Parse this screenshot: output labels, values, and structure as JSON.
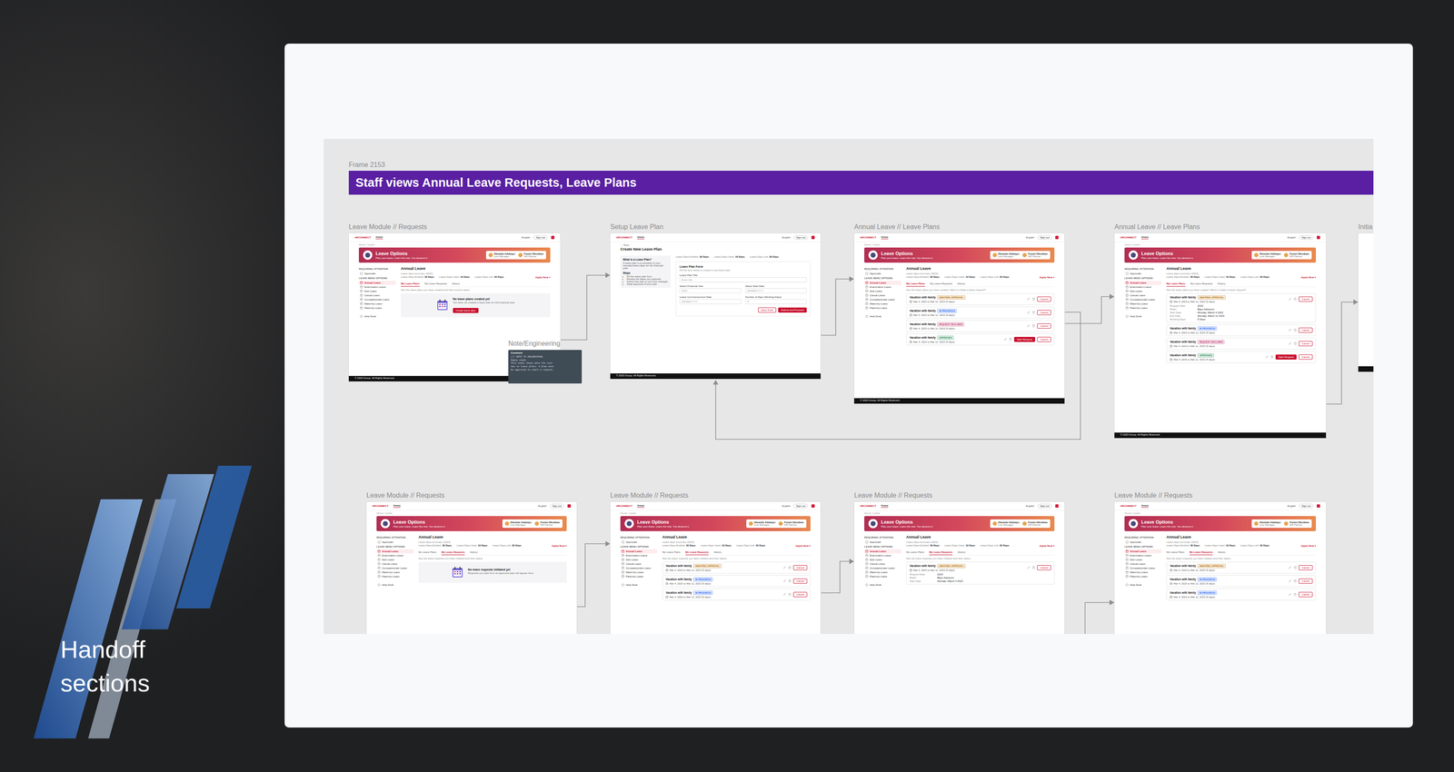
{
  "slide": {
    "title": "Handoff sections"
  },
  "canvas": {
    "frame_name": "Frame 2153",
    "banner": "Staff views Annual Leave Requests, Leave Plans",
    "shell": {
      "logo": "HRCONNECT",
      "nav": "Home",
      "language": "English",
      "sign_out": "Sign out",
      "breadcrumb": "Home / Leave",
      "hero": {
        "title": "Leave Options",
        "subtitle": "Plan your leave. Learn the rest. You deserve it."
      },
      "people": [
        {
          "name": "Olumide Adebayo",
          "role": "Line Manager"
        },
        {
          "name": "Funmi Okonkwo",
          "role": "HR Partner"
        }
      ],
      "attention_heading": "REQUIRING ATTENTION",
      "attention_item": "Approvals",
      "menu_heading": "LEAVE MENU OPTIONS",
      "menu": [
        {
          "label": "Annual Leave",
          "selected": true
        },
        {
          "label": "Examination Leave",
          "selected": false
        },
        {
          "label": "Sick Leave",
          "selected": false
        },
        {
          "label": "Casual Leave",
          "selected": false
        },
        {
          "label": "Compassionate Leave",
          "selected": false
        },
        {
          "label": "Maternity Leave",
          "selected": false
        },
        {
          "label": "Paternity Leave",
          "selected": false
        }
      ],
      "help": "Help Desk",
      "page_title": "Annual Leave",
      "stats_caption": "Leave days summary (2023)",
      "stats": [
        {
          "label": "Leave Days Entitled",
          "value": "30 Days"
        },
        {
          "label": "Leave Days Used",
          "value": "10 Days"
        },
        {
          "label": "Leave Days Left",
          "value": "20 Days"
        }
      ],
      "apply": "Apply Now ▾",
      "footer": "© 2023 Group. All Rights Reserved."
    },
    "note": {
      "label": "Note/Engineering",
      "header": "Comment",
      "lines": [
        "/// NOTE TO ENGINEERING",
        "Empty state",
        "This state shows when the user",
        "has no leave plans. A plan must",
        "be approved to start a request."
      ]
    },
    "frames": [
      {
        "label": "Leave Module // Requests",
        "kind": "empty",
        "tabs": [
          {
            "label": "My Leave Plans",
            "selected": true
          },
          {
            "label": "My Leave Requests",
            "selected": false
          },
          {
            "label": "History",
            "selected": false
          }
        ],
        "tab_note": "See the leave plans you have created and their current status.",
        "empty": {
          "title": "No leave plans created yet",
          "text": "You have not created a leave plan for this financial year.",
          "button": "Create leave plan"
        }
      },
      {
        "label": "Setup Leave Plan",
        "kind": "form",
        "back": "← Back",
        "title": "Create New Leave Plan",
        "info": {
          "title": "What is a Leave Plan?",
          "text": "A leave plan is a schedule of your intended leave days for the financial year.",
          "steps_title": "Steps",
          "steps": [
            "Fill the leave plan form",
            "Review the dates you selected",
            "Submit the plan to your line manager",
            "Await approval of your plan"
          ]
        },
        "form": {
          "title": "Leave Plan Form",
          "text": "Fill the form below to create a new leave plan.",
          "fields": [
            {
              "label": "Leave Plan Title",
              "placeholder": "Enter title"
            },
            {
              "label": "Select Financial Year",
              "placeholder": "2023"
            },
            {
              "label": "Select Start Date",
              "placeholder": "DD/MM/YYYY"
            },
            {
              "label": "Leave Commencement Date",
              "placeholder": "DD/MM/YYYY"
            },
            {
              "label": "Number of Days (Working Days)",
              "placeholder": "0"
            }
          ],
          "buttons": [
            {
              "label": "Save Draft",
              "kind": "outline"
            },
            {
              "label": "Submit and Proceed",
              "kind": "primary"
            }
          ]
        }
      },
      {
        "label": "Annual Leave // Leave Plans",
        "kind": "list",
        "tabs": [
          {
            "label": "My Leave Plans",
            "selected": true
          },
          {
            "label": "My Leave Requests",
            "selected": false
          },
          {
            "label": "History",
            "selected": false
          }
        ],
        "tab_note": "See the leave plans you have created. Want to initiate a leave request?",
        "items": [
          {
            "title": "Vacation with family",
            "status": "AWAITING APPROVAL",
            "color": "#b86e00",
            "date": "Mar 4, 2023 to Mar 11, 2023 (5 days)",
            "expanded": false,
            "actions": [
              {
                "label": "Cancel",
                "kind": "outline"
              }
            ]
          },
          {
            "title": "Vacation with family",
            "status": "IN PROGRESS",
            "color": "#2563eb",
            "date": "Mar 4, 2023 to Mar 11, 2023 (5 days)",
            "expanded": false,
            "actions": [
              {
                "label": "Cancel",
                "kind": "outline"
              }
            ]
          },
          {
            "title": "Vacation with family",
            "status": "REQUEST DECLINED",
            "color": "#c0306a",
            "date": "Mar 4, 2023 to Mar 11, 2023 (5 days)",
            "expanded": false,
            "actions": [
              {
                "label": "Cancel",
                "kind": "outline"
              }
            ]
          },
          {
            "title": "Vacation with family",
            "status": "APPROVED",
            "color": "#1f8a55",
            "date": "Mar 4, 2023 to Mar 11, 2023 (5 days)",
            "expanded": false,
            "actions": [
              {
                "label": "Start Request",
                "kind": "primary"
              },
              {
                "label": "Cancel",
                "kind": "outline"
              }
            ]
          }
        ]
      },
      {
        "label": "Annual Leave // Leave Plans",
        "kind": "list",
        "tabs": [
          {
            "label": "My Leave Plans",
            "selected": true
          },
          {
            "label": "My Leave Requests",
            "selected": false
          },
          {
            "label": "History",
            "selected": false
          }
        ],
        "tab_note": "See the leave plans you have created. Want to initiate a leave request?",
        "items": [
          {
            "title": "Vacation with family",
            "status": "AWAITING APPROVAL",
            "color": "#b86e00",
            "date": "Mar 4, 2023 to Mar 11, 2023 (5 days)",
            "expanded": true,
            "actions": [
              {
                "label": "Cancel",
                "kind": "outline"
              }
            ],
            "details": [
              {
                "key": "Request Date",
                "value": "2023"
              },
              {
                "key": "Relief",
                "value": "Bayo Adewumi"
              },
              {
                "key": "Start Date",
                "value": "Monday, March 4 2023"
              },
              {
                "key": "End Date",
                "value": "Monday, March 11 2023"
              },
              {
                "key": "Working Days",
                "value": "5 Days"
              }
            ]
          },
          {
            "title": "Vacation with family",
            "status": "IN PROGRESS",
            "color": "#2563eb",
            "date": "Mar 4, 2023 to Mar 11, 2023 (5 days)",
            "expanded": false,
            "actions": [
              {
                "label": "Cancel",
                "kind": "outline"
              }
            ]
          },
          {
            "title": "Vacation with family",
            "status": "REQUEST DECLINED",
            "color": "#c0306a",
            "date": "Mar 4, 2023 to Mar 11, 2023 (5 days)",
            "expanded": false,
            "actions": [
              {
                "label": "Cancel",
                "kind": "outline"
              }
            ]
          },
          {
            "title": "Vacation with family",
            "status": "APPROVED",
            "color": "#1f8a55",
            "date": "Mar 4, 2023 to Mar 11, 2023 (5 days)",
            "expanded": false,
            "actions": [
              {
                "label": "Start Request",
                "kind": "primary"
              },
              {
                "label": "Cancel",
                "kind": "outline"
              }
            ]
          }
        ]
      },
      {
        "label": "Initia",
        "kind": "blank"
      },
      {
        "label": "Leave Module // Requests",
        "kind": "empty",
        "tabs": [
          {
            "label": "My Leave Plans",
            "selected": false
          },
          {
            "label": "My Leave Requests",
            "selected": true
          },
          {
            "label": "History",
            "selected": false
          }
        ],
        "tab_note": "See the leave requests you have initiated and their status.",
        "empty": {
          "title": "No leave requests initiated yet",
          "text": "Requests you start from an approved plan will appear here."
        }
      },
      {
        "label": "Leave Module // Requests",
        "kind": "list",
        "tabs": [
          {
            "label": "My Leave Plans",
            "selected": false
          },
          {
            "label": "My Leave Requests",
            "selected": true
          },
          {
            "label": "History",
            "selected": false
          }
        ],
        "tab_note": "See the leave requests you have initiated and their status.",
        "items": [
          {
            "title": "Vacation with family",
            "status": "AWAITING APPROVAL",
            "color": "#b86e00",
            "date": "Mar 4, 2023 to Mar 11, 2023 (5 days)",
            "expanded": false,
            "actions": [
              {
                "label": "Cancel",
                "kind": "outline"
              }
            ]
          },
          {
            "title": "Vacation with family",
            "status": "IN PROGRESS",
            "color": "#2563eb",
            "date": "Mar 4, 2023 to Mar 11, 2023 (5 days)",
            "expanded": false,
            "actions": [
              {
                "label": "Cancel",
                "kind": "outline"
              }
            ]
          },
          {
            "title": "Vacation with family",
            "status": "IN PROGRESS",
            "color": "#2563eb",
            "date": "Mar 4, 2023 to Mar 11, 2023 (5 days)",
            "expanded": false,
            "actions": [
              {
                "label": "Cancel",
                "kind": "outline"
              }
            ]
          }
        ]
      },
      {
        "label": "Leave Module // Requests",
        "kind": "list",
        "tabs": [
          {
            "label": "My Leave Plans",
            "selected": false
          },
          {
            "label": "My Leave Requests",
            "selected": true
          },
          {
            "label": "History",
            "selected": false
          }
        ],
        "tab_note": "See the leave requests you have initiated and their status.",
        "items": [
          {
            "title": "Vacation with family",
            "status": "AWAITING APPROVAL",
            "color": "#b86e00",
            "date": "Mar 4, 2023 to Mar 11, 2023 (5 days)",
            "expanded": true,
            "actions": [
              {
                "label": "Cancel",
                "kind": "outline"
              }
            ],
            "details": [
              {
                "key": "Request Date",
                "value": "2023"
              },
              {
                "key": "Relief",
                "value": "Bayo Adewumi"
              },
              {
                "key": "Start Date",
                "value": "Monday, March 4 2023"
              }
            ]
          }
        ]
      },
      {
        "label": "Leave Module // Requests",
        "kind": "list",
        "tabs": [
          {
            "label": "My Leave Plans",
            "selected": false
          },
          {
            "label": "My Leave Requests",
            "selected": true
          },
          {
            "label": "History",
            "selected": false
          }
        ],
        "tab_note": "See the leave requests you have initiated and their status.",
        "items": [
          {
            "title": "Vacation with family",
            "status": "AWAITING APPROVAL",
            "color": "#b86e00",
            "date": "Mar 4, 2023 to Mar 11, 2023 (5 days)",
            "expanded": false,
            "actions": [
              {
                "label": "Cancel",
                "kind": "outline"
              }
            ]
          },
          {
            "title": "Vacation with family",
            "status": "IN PROGRESS",
            "color": "#2563eb",
            "date": "Mar 4, 2023 to Mar 11, 2023 (5 days)",
            "expanded": false,
            "actions": [
              {
                "label": "Cancel",
                "kind": "outline"
              }
            ]
          },
          {
            "title": "Vacation with family",
            "status": "IN PROGRESS",
            "color": "#2563eb",
            "date": "Mar 4, 2023 to Mar 11, 2023 (5 days)",
            "expanded": false,
            "actions": [
              {
                "label": "Cancel",
                "kind": "outline"
              }
            ]
          }
        ]
      }
    ]
  }
}
